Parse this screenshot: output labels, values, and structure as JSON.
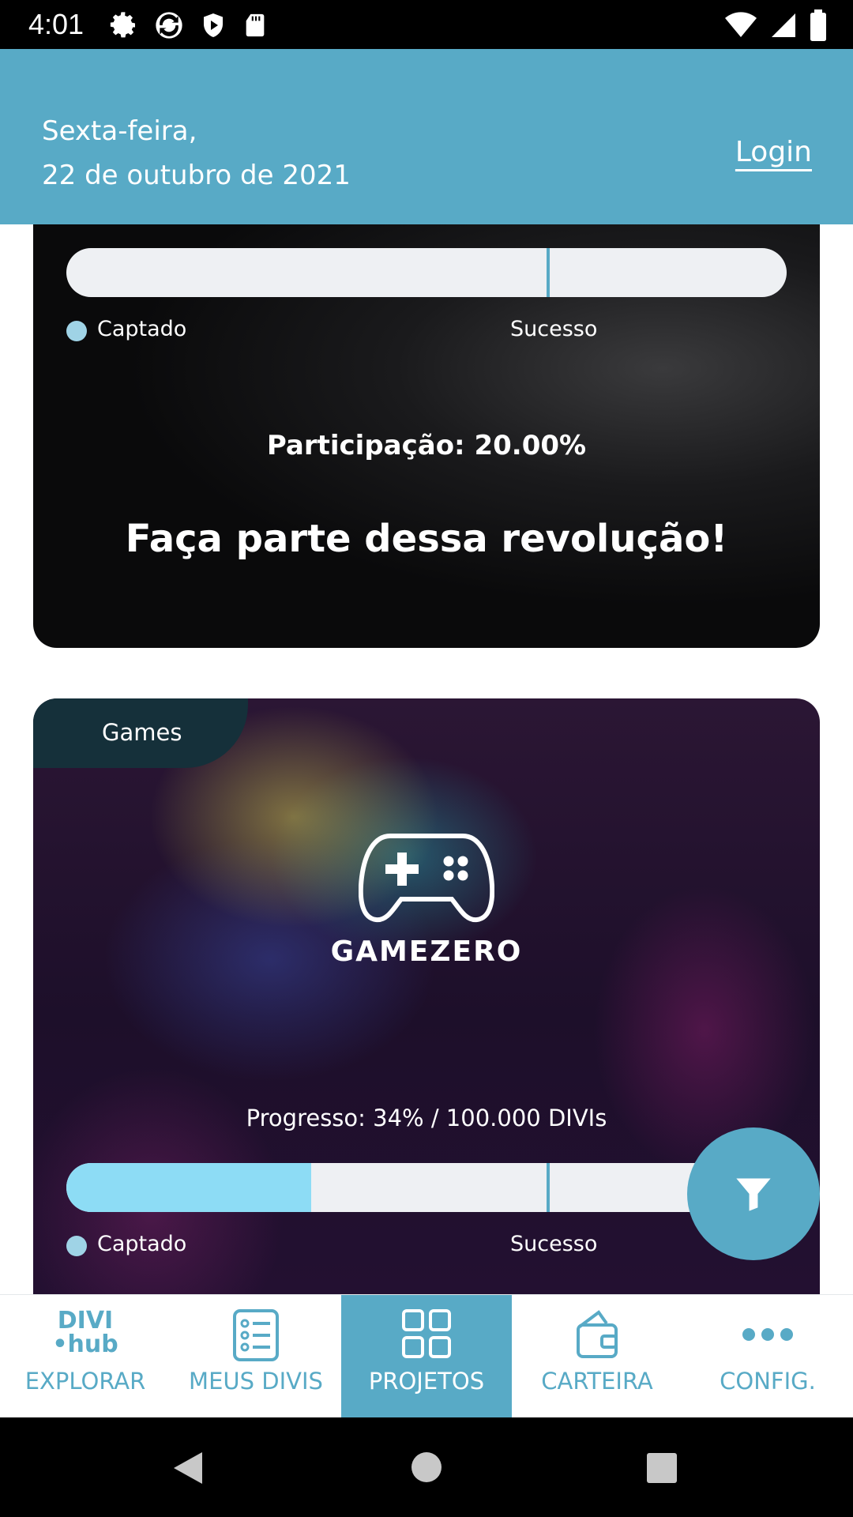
{
  "status_bar": {
    "time": "4:01"
  },
  "header": {
    "day": "Sexta-feira,",
    "date": "22 de outubro de 2021",
    "login_label": "Login"
  },
  "card1": {
    "progress": 0,
    "legend_raised": "Captado",
    "legend_success": "Sucesso",
    "participation": "Participação: 20.00%",
    "headline": "Faça parte dessa revolução!"
  },
  "card2": {
    "category": "Games",
    "logo_text": "GAMEZERO",
    "progress_text": "Progresso: 34% / 100.000 DIVIs",
    "progress": 0.34,
    "legend_raised": "Captado",
    "legend_success": "Sucesso"
  },
  "bottom_nav": {
    "items": [
      {
        "label": "EXPLORAR",
        "logo_top": "DIVI",
        "logo_bottom": "•hub"
      },
      {
        "label": "MEUS DIVIS"
      },
      {
        "label": "PROJETOS"
      },
      {
        "label": "CARTEIRA"
      },
      {
        "label": "CONFIG."
      }
    ],
    "active": "PROJETOS"
  },
  "colors": {
    "primary": "#58aac6",
    "progress_fill": "#8ddcf5",
    "bar_bg": "#eef0f3",
    "tag_bg": "#15303a"
  },
  "icons": [
    "settings-icon",
    "sync-icon",
    "shield-icon",
    "sd-card-icon",
    "wifi-icon",
    "signal-icon",
    "battery-icon",
    "gamepad-icon",
    "filter-icon",
    "list-icon",
    "grid-icon",
    "wallet-icon",
    "more-icon",
    "back-icon",
    "home-icon",
    "recents-icon"
  ]
}
